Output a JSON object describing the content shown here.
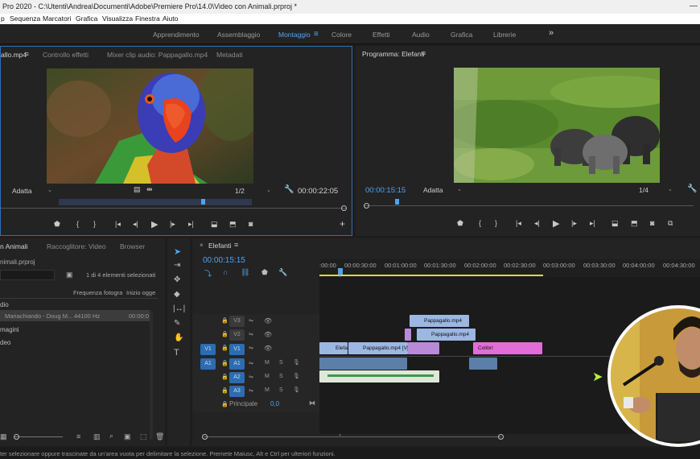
{
  "title_bar": {
    "title": "Pro 2020 - C:\\Utenti\\Andrea\\Documenti\\Adobe\\Premiere Pro\\14.0\\Video con Animali.prproj *",
    "minimize": "—"
  },
  "menu": [
    "p",
    "Sequenza",
    "Marcatori",
    "Grafica",
    "Visualizza",
    "Finestra",
    "Aiuto"
  ],
  "workspaces": {
    "items": [
      "Apprendimento",
      "Assemblaggio",
      "Montaggio",
      "Colore",
      "Effetti",
      "Audio",
      "Grafica",
      "Librerie"
    ],
    "active": "Montaggio",
    "more": "»"
  },
  "source_monitor": {
    "tabs": [
      "allo.mp4",
      "Controllo effetti",
      "Mixer clip audio: Pappagallo.mp4",
      "Metadati"
    ],
    "zoom": "Adatta",
    "resolution": "1/2",
    "timecode": "00:00:22:05",
    "image_desc": "parrot-frame"
  },
  "program_monitor": {
    "tab": "Programma: Elefanti",
    "timecode": "00:00:15:15",
    "zoom": "Adatta",
    "resolution": "1/4"
  },
  "project": {
    "tabs": [
      "n Animali",
      "Raccoglitore: Video",
      "Browser"
    ],
    "file": "nimali.prproj",
    "count": "1 di 4 elementi selezionati",
    "columns": [
      "Frequenza fotogra",
      "Inizio ogge"
    ],
    "items": [
      {
        "name": "dio",
        "rate": "",
        "start": ""
      },
      {
        "name": "Mariachiando - Doug M...",
        "rate": "44100 Hz",
        "start": "00:00:0"
      },
      {
        "name": "magini",
        "rate": "",
        "start": ""
      },
      {
        "name": "deo",
        "rate": "",
        "start": ""
      }
    ]
  },
  "timeline": {
    "tab": "Elefanti",
    "timecode": "00:00:15:15",
    "ruler": [
      ":00:00",
      "00:00:30:00",
      "00:01:00:00",
      "00:01:30:00",
      "00:02:00:00",
      "00:02:30:00",
      "00:03:00:00",
      "00:03:30:00",
      "00:04:00:00",
      "00:04:30:00"
    ],
    "tracks": {
      "video": [
        "V3",
        "V2",
        "V1"
      ],
      "audio": [
        "A1",
        "A2",
        "A3"
      ],
      "source_v": "V1",
      "source_a": "A1",
      "master": "Principale",
      "master_value": "0,0",
      "mute": "M",
      "solo": "S"
    },
    "clips": {
      "v3": "Pappagallo.mp4",
      "v2": "Pappagallo.mp4",
      "v1_a": "Elefa",
      "v1_b": "Pappagallo.mp4 [V]",
      "v1_c": "Colibrì"
    }
  },
  "status_bar": "ter selezionare oppure trascinate da un'area vuota per delimitare la selezione. Premete Maiusc, Alt e Ctrl per ulteriori funzioni.",
  "colors": {
    "accent": "#4ea3ef",
    "clip_video": "#9cb7e2",
    "clip_purple": "#b88ad8",
    "clip_magenta": "#e06ed6",
    "playhead": "#4ea3ef"
  }
}
